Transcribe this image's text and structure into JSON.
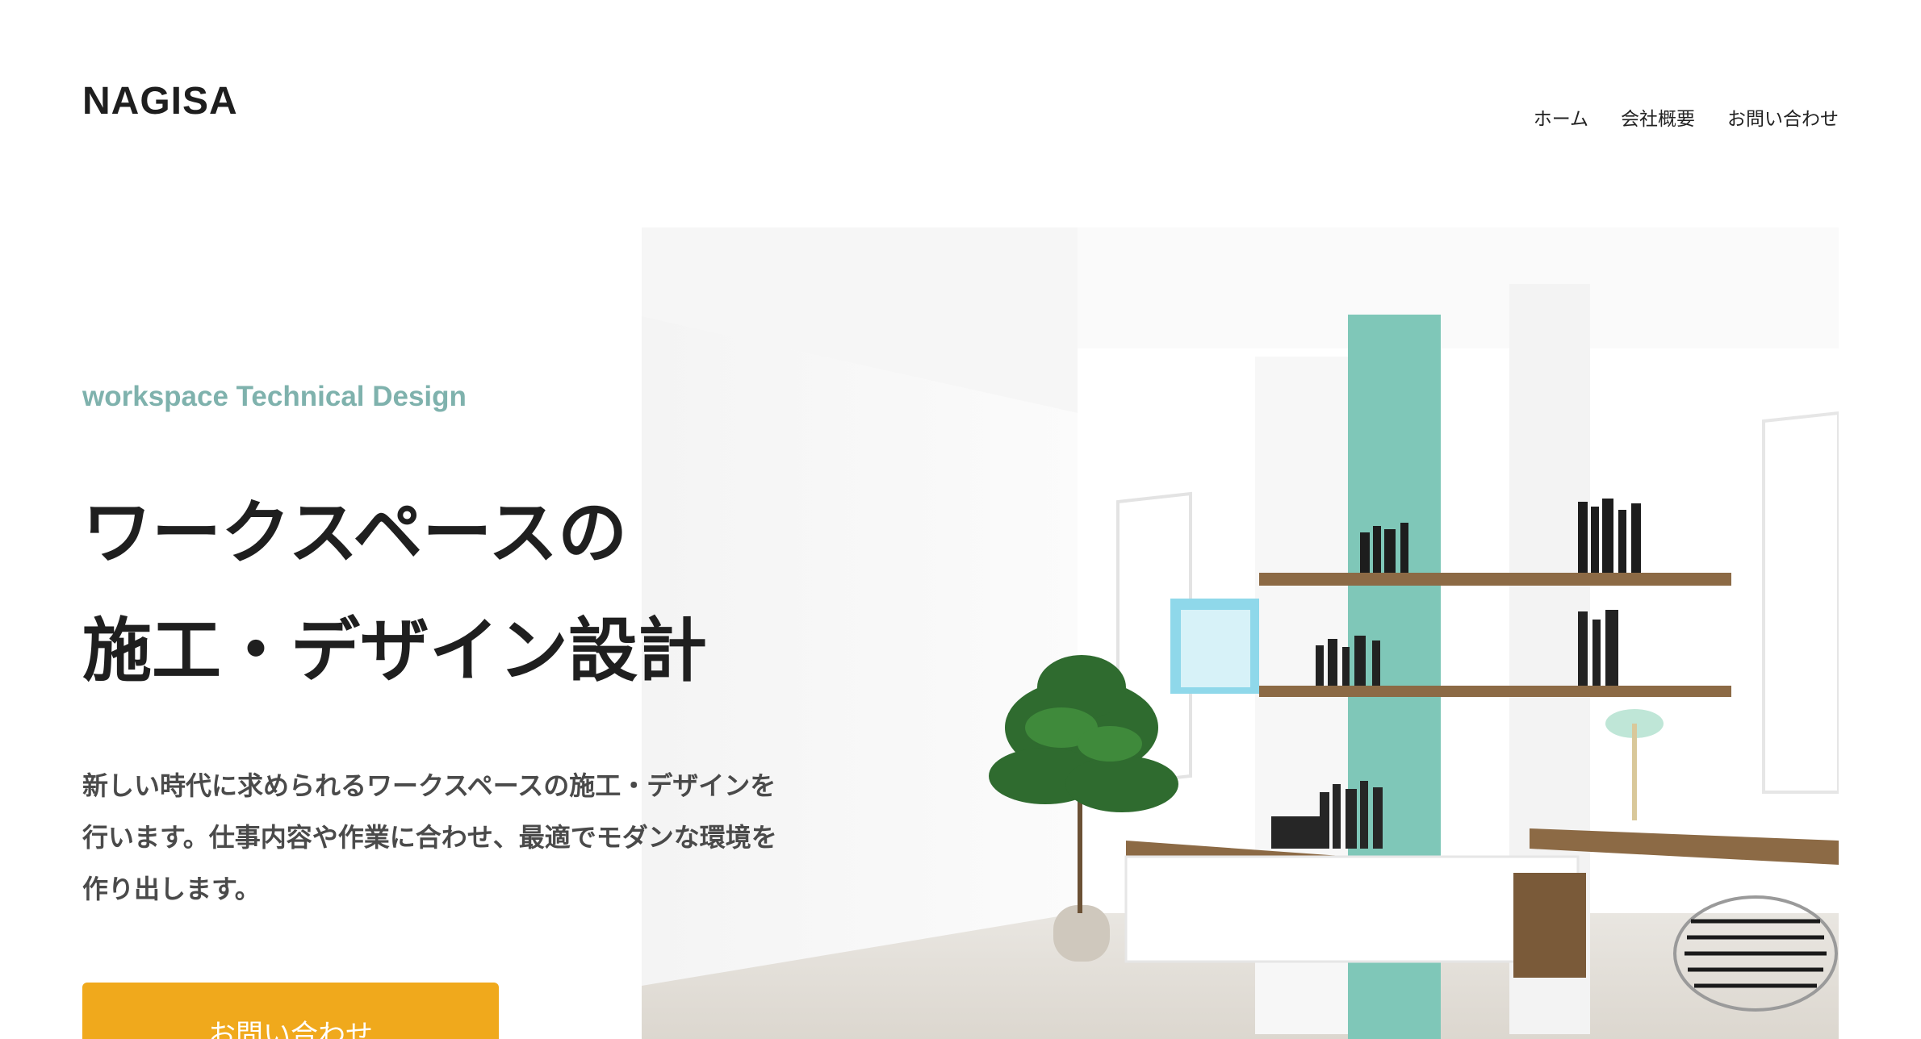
{
  "header": {
    "logo": "NAGISA",
    "nav": [
      {
        "label": "ホーム"
      },
      {
        "label": "会社概要"
      },
      {
        "label": "お問い合わせ"
      }
    ]
  },
  "hero": {
    "eyebrow": "workspace Technical Design",
    "headline": [
      "ワークスペースの",
      "施工・デザイン設計"
    ],
    "description": [
      "新しい時代に求められるワークスペースの施工・デザインを",
      "行います。仕事内容や作業に合わせ、最適でモダンな環境を",
      "作り出します。"
    ],
    "cta_label": "お問い合わせ",
    "image_subject": "modern-workspace-photo"
  },
  "colors": {
    "accent_teal": "#7fb2ad",
    "cta_orange": "#f0a91c",
    "wall_teal": "#7fc7b8"
  }
}
